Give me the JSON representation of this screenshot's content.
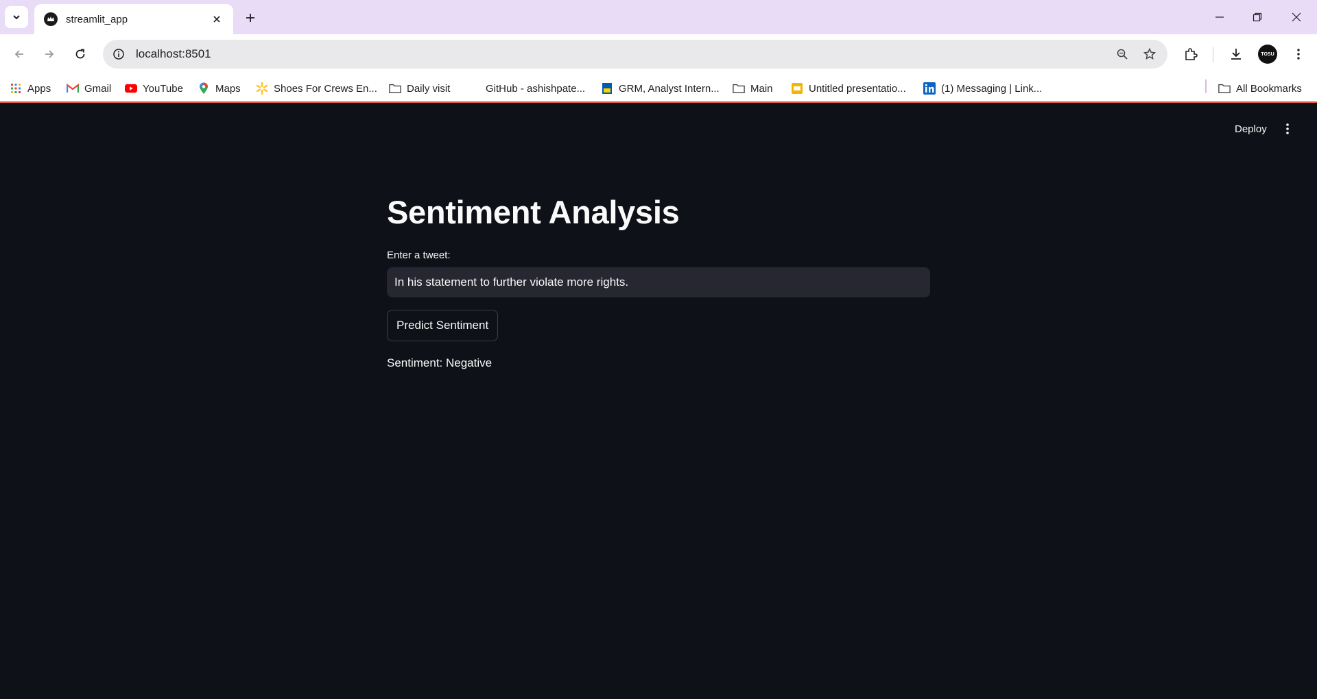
{
  "browser": {
    "tab": {
      "title": "streamlit_app"
    },
    "address": {
      "url": "localhost:8501"
    },
    "profile_initials": "TOSU",
    "bookmarks": [
      {
        "label": "Apps",
        "icon": "apps-grid-icon"
      },
      {
        "label": "Gmail",
        "icon": "gmail-icon"
      },
      {
        "label": "YouTube",
        "icon": "youtube-icon"
      },
      {
        "label": "Maps",
        "icon": "maps-pin-icon"
      },
      {
        "label": "Shoes For Crews En...",
        "icon": "walmart-spark-icon"
      },
      {
        "label": "Daily visit",
        "icon": "folder-icon"
      },
      {
        "label": "GitHub - ashishpate...",
        "icon": "none"
      },
      {
        "label": "GRM, Analyst Intern...",
        "icon": "rbc-icon"
      },
      {
        "label": "Main",
        "icon": "folder-icon"
      },
      {
        "label": "Untitled presentatio...",
        "icon": "slides-icon"
      },
      {
        "label": "(1) Messaging | Link...",
        "icon": "linkedin-icon"
      }
    ],
    "all_bookmarks": "All Bookmarks"
  },
  "app": {
    "deploy_label": "Deploy",
    "title": "Sentiment Analysis",
    "input": {
      "label": "Enter a tweet:",
      "value": "In his statement to further violate more rights."
    },
    "button_label": "Predict Sentiment",
    "result": "Sentiment: Negative"
  },
  "colors": {
    "app_background": "#0e1117",
    "input_background": "#262730",
    "text": "#fafafa",
    "tabstrip": "#e9dcf7",
    "header_accent": "#f05a4a"
  }
}
